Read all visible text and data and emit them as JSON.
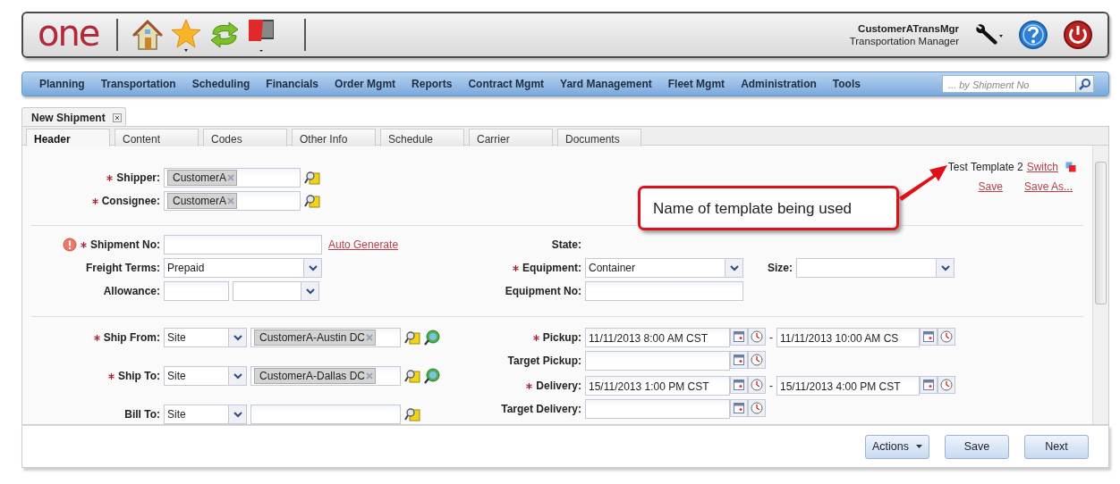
{
  "header": {
    "logo": "one",
    "user_name": "CustomerATransMgr",
    "user_role": "Transportation Manager"
  },
  "menu": {
    "items": [
      "Planning",
      "Transportation",
      "Scheduling",
      "Financials",
      "Order Mgmt",
      "Reports",
      "Contract Mgmt",
      "Yard Management",
      "Fleet Mgmt",
      "Administration",
      "Tools"
    ],
    "search": {
      "placeholder": "... by Shipment No"
    }
  },
  "page_tabs": [
    {
      "label": "New Shipment",
      "selected": true
    }
  ],
  "tabs": [
    {
      "label": "Header",
      "selected": true
    },
    {
      "label": "Content",
      "selected": false
    },
    {
      "label": "Codes",
      "selected": false
    },
    {
      "label": "Other Info",
      "selected": false
    },
    {
      "label": "Schedule",
      "selected": false
    },
    {
      "label": "Carrier",
      "selected": false
    },
    {
      "label": "Documents",
      "selected": false
    }
  ],
  "template": {
    "name": "Test Template 2",
    "switch": "Switch",
    "save": "Save",
    "save_as": "Save As..."
  },
  "callout": {
    "text": "Name of template being used"
  },
  "sections": [
    {
      "columns": [
        [
          {
            "label": "Shipper:",
            "required": true,
            "error": false,
            "controls": [
              {
                "kind": "token",
                "value": "CustomerA"
              },
              {
                "kind": "lookup"
              }
            ]
          },
          {
            "label": "Consignee:",
            "required": true,
            "error": false,
            "controls": [
              {
                "kind": "token",
                "value": "CustomerA"
              },
              {
                "kind": "lookup"
              }
            ]
          }
        ]
      ]
    },
    {
      "columns": [
        [
          {
            "label": "Shipment No:",
            "required": true,
            "error": true,
            "controls": [
              {
                "kind": "text"
              },
              {
                "kind": "link",
                "text": "Auto Generate"
              }
            ]
          },
          {
            "label": "Freight Terms:",
            "required": false,
            "error": false,
            "controls": [
              {
                "kind": "select",
                "value": "Prepaid"
              }
            ]
          },
          {
            "label": "Allowance:",
            "required": false,
            "error": false,
            "controls": [
              {
                "kind": "short-text"
              },
              {
                "kind": "short-select"
              }
            ]
          }
        ],
        [
          {
            "label": "State:",
            "required": false,
            "error": false
          },
          {
            "label": "Equipment:",
            "required": true,
            "error": false,
            "controls": [
              {
                "kind": "select",
                "value": "Container"
              },
              {
                "kind": "label",
                "text": "Size:"
              },
              {
                "kind": "select"
              }
            ]
          },
          {
            "label": "Equipment No:",
            "required": false,
            "error": false,
            "controls": [
              {
                "kind": "text"
              }
            ]
          }
        ]
      ]
    },
    {
      "columns": [
        [
          {
            "label": "Ship From:",
            "required": true,
            "error": false,
            "controls": [
              {
                "kind": "site-select",
                "value": "Site"
              },
              {
                "kind": "site-token",
                "value": "CustomerA-Austin DC"
              },
              {
                "kind": "lookup"
              },
              {
                "kind": "locate"
              }
            ]
          },
          {
            "label": "Ship To:",
            "required": true,
            "error": false,
            "controls": [
              {
                "kind": "site-select",
                "value": "Site"
              },
              {
                "kind": "site-token",
                "value": "CustomerA-Dallas DC"
              },
              {
                "kind": "lookup"
              },
              {
                "kind": "locate"
              }
            ]
          },
          {
            "label": "Bill To:",
            "required": false,
            "error": false,
            "controls": [
              {
                "kind": "site-select",
                "value": "Site"
              },
              {
                "kind": "site-token"
              },
              {
                "kind": "lookup"
              }
            ]
          }
        ],
        [
          {
            "label": "Pickup:",
            "required": true,
            "error": false,
            "controls": [
              {
                "kind": "datetime",
                "value": "11/11/2013 8:00 AM CST"
              },
              {
                "kind": "separator",
                "text": "-"
              },
              {
                "kind": "short-datetime",
                "value": "11/11/2013 10:00 AM CS"
              }
            ]
          },
          {
            "label": "Target Pickup:",
            "required": false,
            "error": false,
            "controls": [
              {
                "kind": "datetime"
              }
            ]
          },
          {
            "label": "Delivery:",
            "required": true,
            "error": false,
            "controls": [
              {
                "kind": "datetime",
                "value": "15/11/2013 1:00 PM CST"
              },
              {
                "kind": "separator",
                "text": "-"
              },
              {
                "kind": "short-datetime",
                "value": "15/11/2013 4:00 PM CST"
              }
            ]
          },
          {
            "label": "Target Delivery:",
            "required": false,
            "error": false,
            "controls": [
              {
                "kind": "datetime"
              }
            ]
          }
        ]
      ]
    }
  ],
  "footer": {
    "buttons": [
      {
        "label": "Actions",
        "kind": "menu"
      },
      {
        "label": "Save",
        "kind": "plain"
      },
      {
        "label": "Next",
        "kind": "plain"
      }
    ]
  }
}
